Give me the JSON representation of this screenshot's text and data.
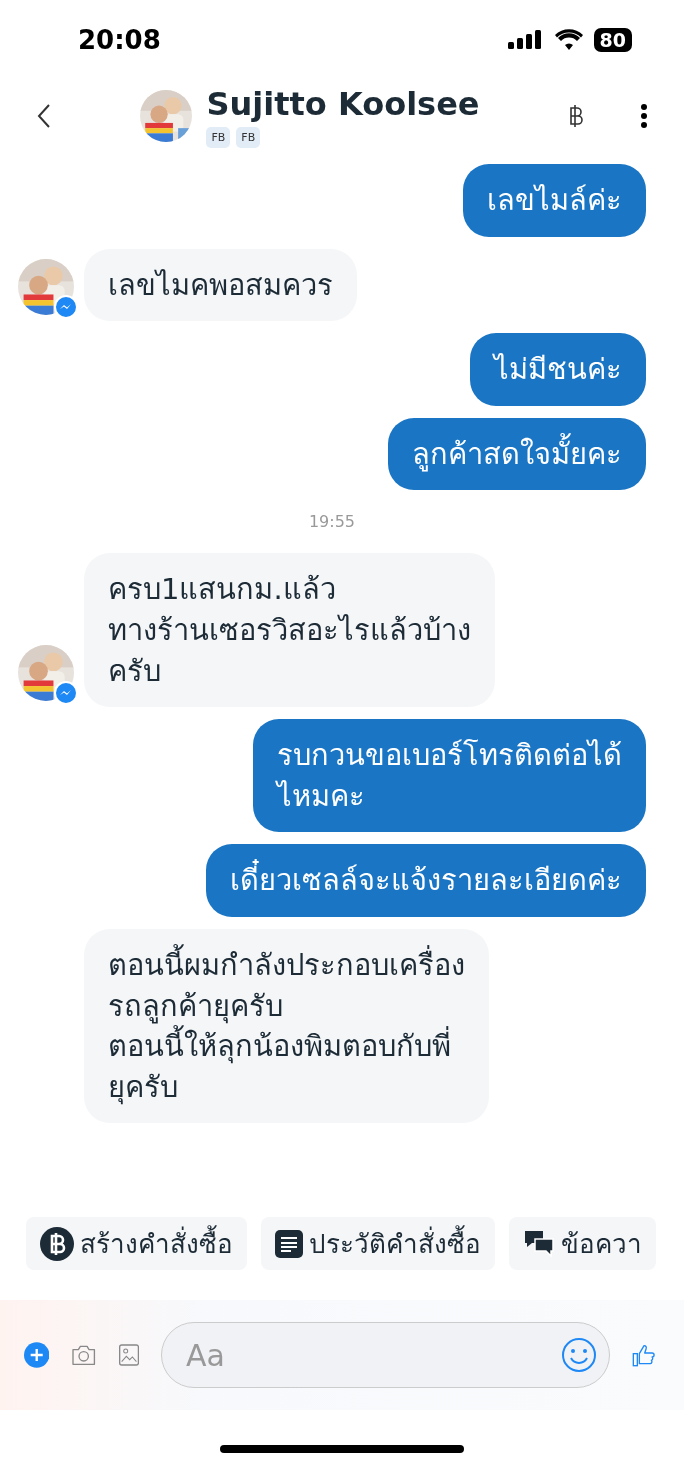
{
  "status_bar": {
    "time": "20:08",
    "battery": "80"
  },
  "header": {
    "name": "Sujitto Koolsee",
    "tags": [
      "FB",
      "FB"
    ]
  },
  "messages": [
    {
      "kind": "sent",
      "text": "เลขไมล์ค่ะ"
    },
    {
      "kind": "received",
      "text": "เลขไมคพอสมควร",
      "avatar": true
    },
    {
      "kind": "sent",
      "text": "ไม่มีชนค่ะ"
    },
    {
      "kind": "sent",
      "text": "ลูกค้าสดใจมั้ยคะ"
    },
    {
      "kind": "time",
      "text": "19:55"
    },
    {
      "kind": "received",
      "text": "ครบ1แสนกม.แล้ว\nทางร้านเซอรวิสอะไรแล้วบ้าง\nครับ",
      "avatar": true
    },
    {
      "kind": "sent",
      "text": "รบกวนขอเบอร์โทรติดต่อได้\nไหมคะ"
    },
    {
      "kind": "sent",
      "text": "เดี๋ยวเซลล์จะแจ้งรายละเอียดค่ะ"
    },
    {
      "kind": "received",
      "text": "ตอนนี้ผมกำลังประกอบเครื่อง\nรถลูกค้ายุครับ\nตอนนี้ให้ลุกน้องพิมตอบกับพี่\nยุครับ",
      "avatar": false
    }
  ],
  "quick_replies": [
    {
      "kind": "baht",
      "label": "สร้างคำสั่งซื้อ"
    },
    {
      "kind": "list",
      "label": "ประวัติคำสั่งซื้อ"
    },
    {
      "kind": "chat",
      "label": "ข้อควา"
    }
  ],
  "composer": {
    "placeholder": "Aa"
  }
}
